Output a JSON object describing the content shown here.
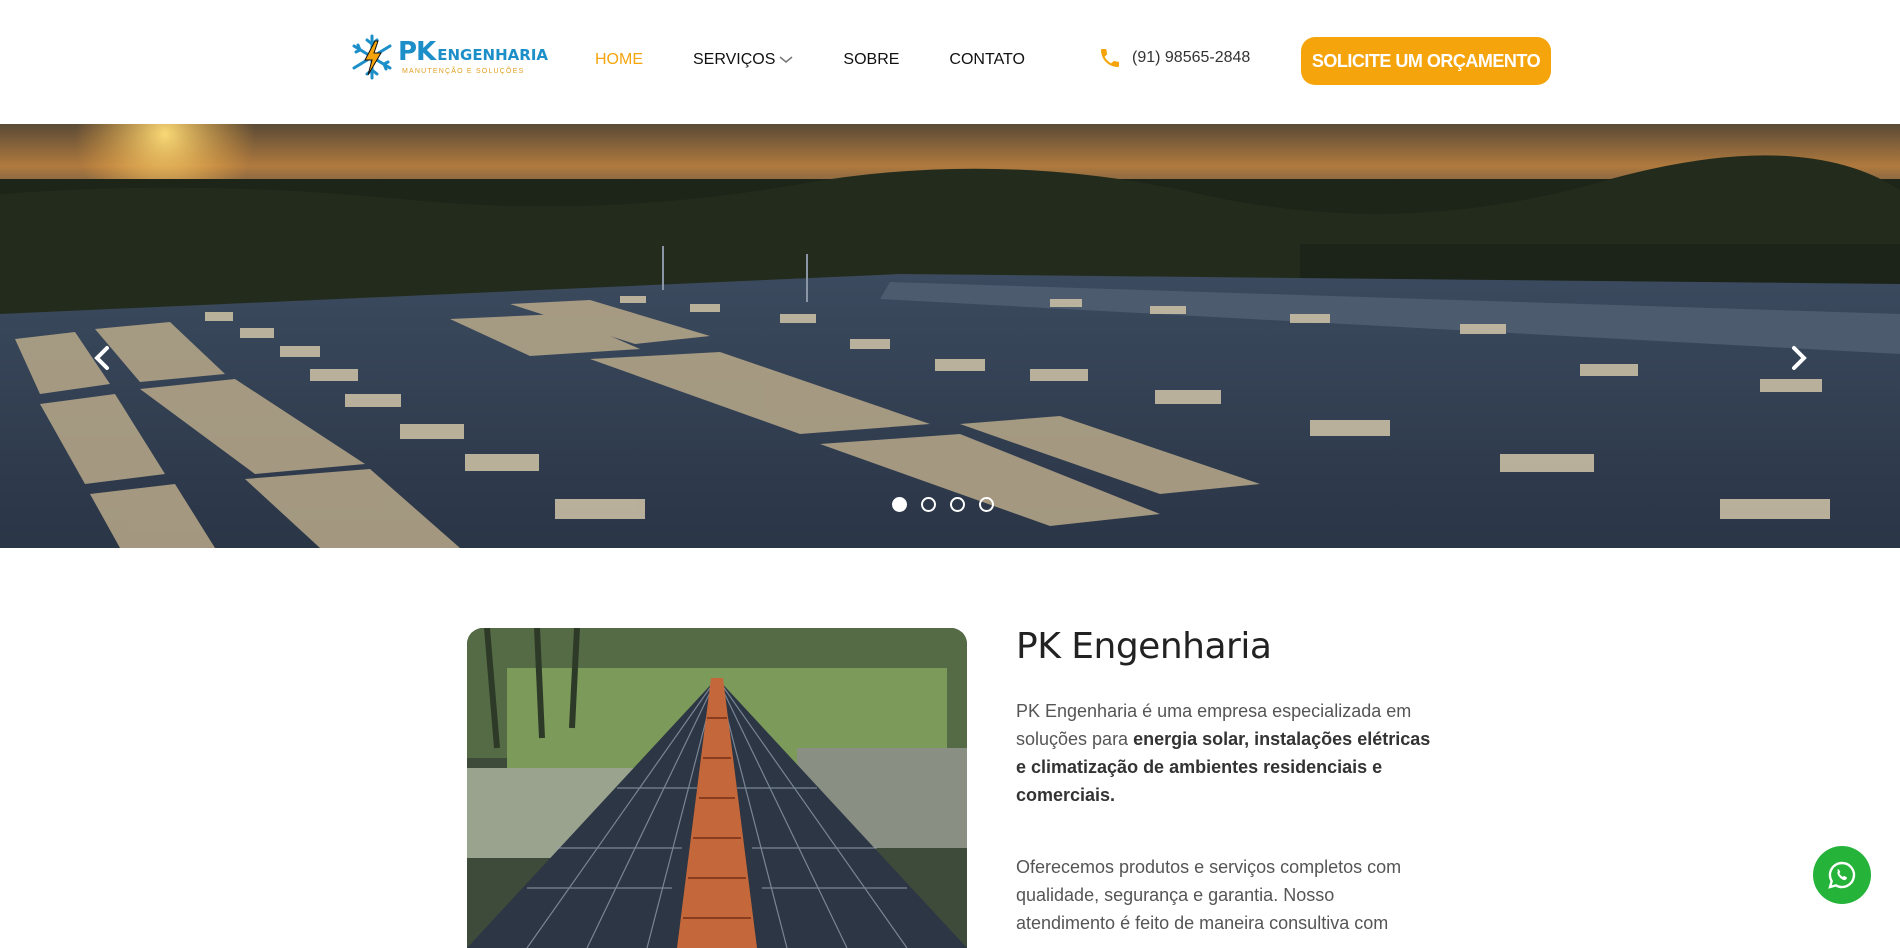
{
  "header": {
    "logo": {
      "brand_pk": "PK",
      "brand_name": "ENGENHARIA",
      "tagline": "MANUTENÇÃO E SOLUÇÕES"
    },
    "nav": [
      {
        "label": "HOME",
        "active": true
      },
      {
        "label": "SERVIÇOS",
        "has_dropdown": true
      },
      {
        "label": "SOBRE"
      },
      {
        "label": "CONTATO"
      }
    ],
    "phone": "(91) 98565-2848",
    "cta_label": "SOLICITE UM ORÇAMENTO"
  },
  "hero": {
    "slides_count": 4,
    "active_slide": 1,
    "prev_icon": "chevron-left-icon",
    "next_icon": "chevron-right-icon"
  },
  "about": {
    "title": "PK Engenharia",
    "p1_intro": "PK Engenharia é uma empresa especializada em soluções para ",
    "p1_bold": "energia solar, instalações elétricas e climatização de ambientes residenciais e comerciais.",
    "p2": "Oferecemos produtos e serviços completos com qualidade, segurança e garantia. Nosso atendimento é feito de maneira consultiva com"
  },
  "floating": {
    "whatsapp_icon": "whatsapp-icon"
  },
  "colors": {
    "accent": "#f5a40c",
    "brand_blue": "#1c8fc9",
    "whatsapp": "#25b33a"
  }
}
